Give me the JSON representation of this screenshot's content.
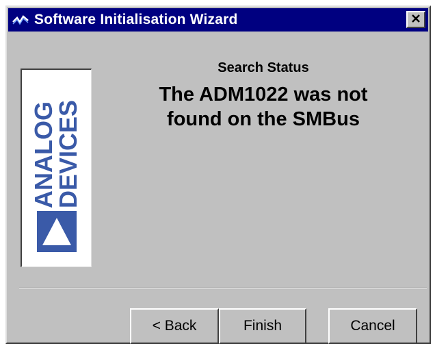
{
  "window": {
    "title": "Software Initialisation Wizard",
    "title_bar_color": "#000080",
    "icons": {
      "app": "waveform-icon",
      "close": "close-icon"
    }
  },
  "logo": {
    "line1": "ANALOG",
    "line2": "DEVICES",
    "brand_color": "#3a5aa8",
    "icon": "triangle-logo-icon"
  },
  "status": {
    "heading": "Search Status",
    "message_line1": "The ADM1022 was not",
    "message_line2": "found on the SMBus"
  },
  "buttons": {
    "back": "< Back",
    "finish": "Finish",
    "cancel": "Cancel"
  }
}
